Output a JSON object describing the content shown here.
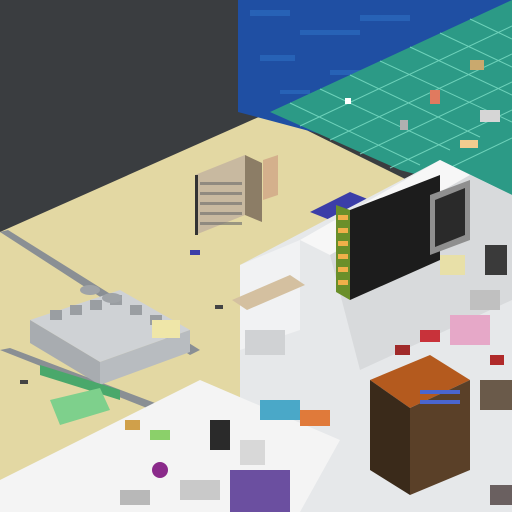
{
  "view": {
    "type": "isometric-factory-game",
    "colors": {
      "void": "#3a3d40",
      "sand": "#e3d8a3",
      "sand_edge": "#cfc38c",
      "water": "#1f4fa3",
      "water_light": "#2f73c6",
      "grid_floor": "#2c9a86",
      "grid_line": "#7fe0c8",
      "concrete": "#e6e8ea",
      "concrete_dark": "#bfc3c7",
      "wall": "#f1f2f3",
      "belt": "#8a8f94"
    },
    "icons": [
      "storage-rack",
      "assembly-machine",
      "smelter-array",
      "crafting-tower",
      "conveyor-belt",
      "server-tower"
    ]
  }
}
